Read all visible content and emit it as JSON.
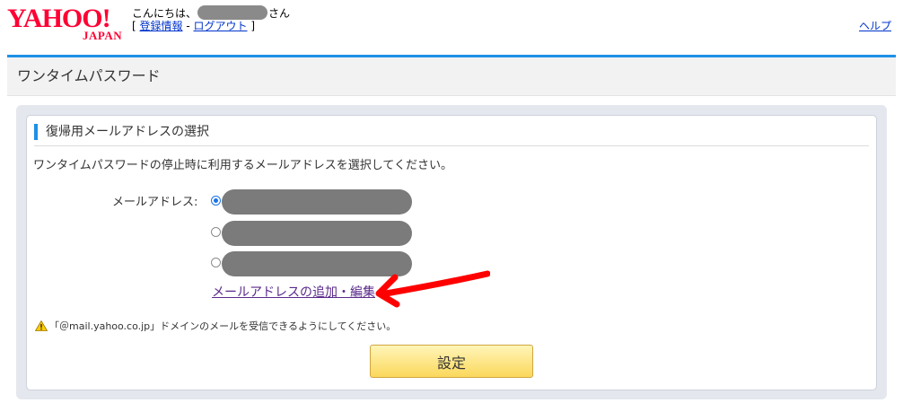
{
  "header": {
    "logo_main": "YAHOO!",
    "logo_sub": "JAPAN",
    "greeting_prefix": "こんにちは、",
    "greeting_suffix": "さん",
    "bracket_open": "[ ",
    "register_link": "登録情報",
    "separator": " - ",
    "logout_link": "ログアウト",
    "bracket_close": " ]",
    "help_link": "ヘルプ"
  },
  "page": {
    "title": "ワンタイムパスワード"
  },
  "section": {
    "heading": "復帰用メールアドレスの選択",
    "description": "ワンタイムパスワードの停止時に利用するメールアドレスを選択してください。",
    "email_label": "メールアドレス:",
    "email_options": [
      {
        "selected": true
      },
      {
        "selected": false
      },
      {
        "selected": false
      }
    ],
    "edit_link": "メールアドレスの追加・編集",
    "notice": "「＠mail.yahoo.co.jp」ドメインのメールを受信できるようにしてください。",
    "submit_label": "設定"
  },
  "colors": {
    "brand_red": "#ff0033",
    "accent_blue": "#1e90e6",
    "button_yellow": "#fbd85c",
    "annotation_arrow": "#ff0000"
  }
}
